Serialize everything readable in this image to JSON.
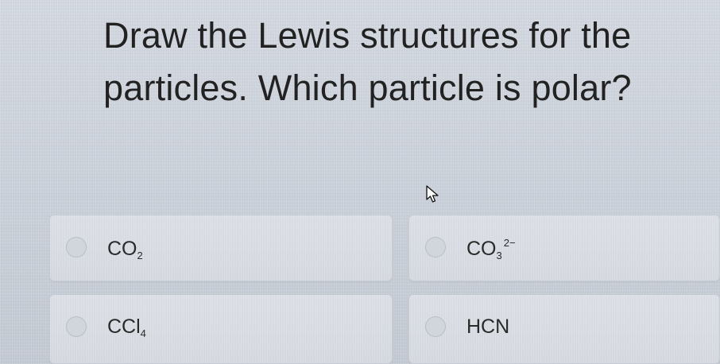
{
  "question": {
    "line1": "Draw the Lewis structures for the",
    "line2": "particles. Which particle is polar?"
  },
  "options": [
    {
      "base": "CO",
      "subscript": "2",
      "superscript": ""
    },
    {
      "base": "CO",
      "subscript": "3",
      "superscript": "2−"
    },
    {
      "base": "CCl",
      "subscript": "4",
      "superscript": ""
    },
    {
      "base": "HCN",
      "subscript": "",
      "superscript": ""
    }
  ],
  "icons": {
    "cursor": "mouse-pointer-arrow",
    "radio": "radio-button-unselected"
  },
  "colors": {
    "background": "#d3d8e0",
    "text": "#222222",
    "option_card": "#dadee5"
  }
}
